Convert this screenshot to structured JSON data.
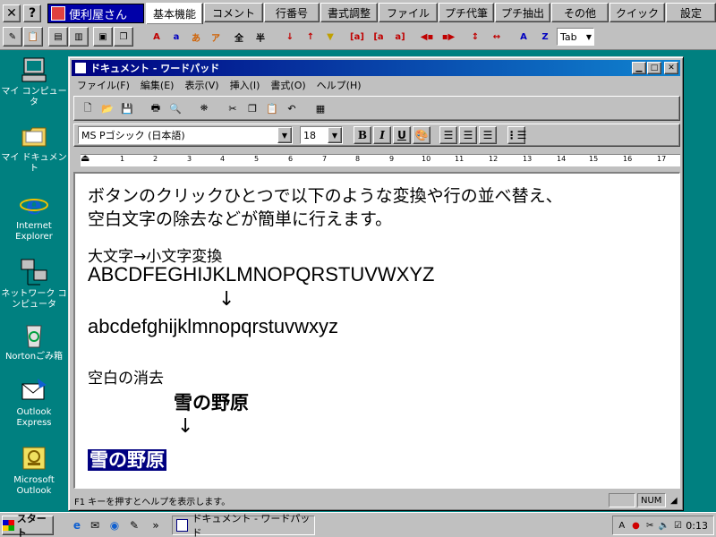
{
  "topbar": {
    "close_glyph": "✕",
    "help_glyph": "?",
    "app_name": "便利屋さん",
    "tabs": [
      "基本機能",
      "コメント",
      "行番号",
      "書式調整",
      "ファイル",
      "プチ代筆",
      "プチ抽出",
      "その他",
      "クイック",
      "設定"
    ],
    "tool_labels": [
      "A",
      "a",
      "あ",
      "ア",
      "全",
      "半",
      "A",
      "Z",
      "A",
      "Z"
    ],
    "tab_select_value": "Tab"
  },
  "desktop": {
    "icons": [
      {
        "label": "マイ コンピュータ",
        "icon": "computer-icon"
      },
      {
        "label": "マイ ドキュメント",
        "icon": "folder-icon"
      },
      {
        "label": "Internet Explorer",
        "icon": "ie-icon"
      },
      {
        "label": "ネットワーク コンピュータ",
        "icon": "network-icon"
      },
      {
        "label": "Nortonごみ箱",
        "icon": "recycle-bin-icon"
      },
      {
        "label": "Outlook Express",
        "icon": "outlook-express-icon"
      },
      {
        "label": "Microsoft Outlook",
        "icon": "outlook-icon"
      }
    ]
  },
  "wordpad": {
    "title": "ドキュメント - ワードパッド",
    "menu": [
      "ファイル(F)",
      "編集(E)",
      "表示(V)",
      "挿入(I)",
      "書式(O)",
      "ヘルプ(H)"
    ],
    "font_name": "MS Pゴシック (日本語)",
    "font_size": "18",
    "format_labels": {
      "bold": "B",
      "italic": "I",
      "underline": "U"
    },
    "ruler_ticks": [
      "1",
      "2",
      "3",
      "4",
      "5",
      "6",
      "7",
      "8",
      "9",
      "10",
      "11",
      "12",
      "13",
      "14",
      "15",
      "16",
      "17"
    ],
    "doc": {
      "line1": "ボタンのクリックひとつで以下のような変換や行の並べ替え、",
      "line2": "空白文字の除去などが簡単に行えます。",
      "section1": "大文字→小文字変換",
      "upper": "ABCDFEGHIJKLMNOPQRSTUVWXYZ",
      "arrow": "↓",
      "lower": "abcdefghijklmnopqrstuvwxyz",
      "section2": "空白の消去",
      "spaced_text": "雪の野原",
      "result_text": "雪の野原"
    },
    "status_message": "F1 キーを押すとヘルプを表示します。",
    "status_num": "NUM"
  },
  "taskbar": {
    "start_label": "スタート",
    "chevron": "»",
    "task_label": "ドキュメント - ワードパッド",
    "tray_ime": "A",
    "clock": "0:13"
  },
  "colors": {
    "desktop": "#008080",
    "titlebar": "#000080",
    "selection": "#000080",
    "face": "#c0c0c0"
  }
}
